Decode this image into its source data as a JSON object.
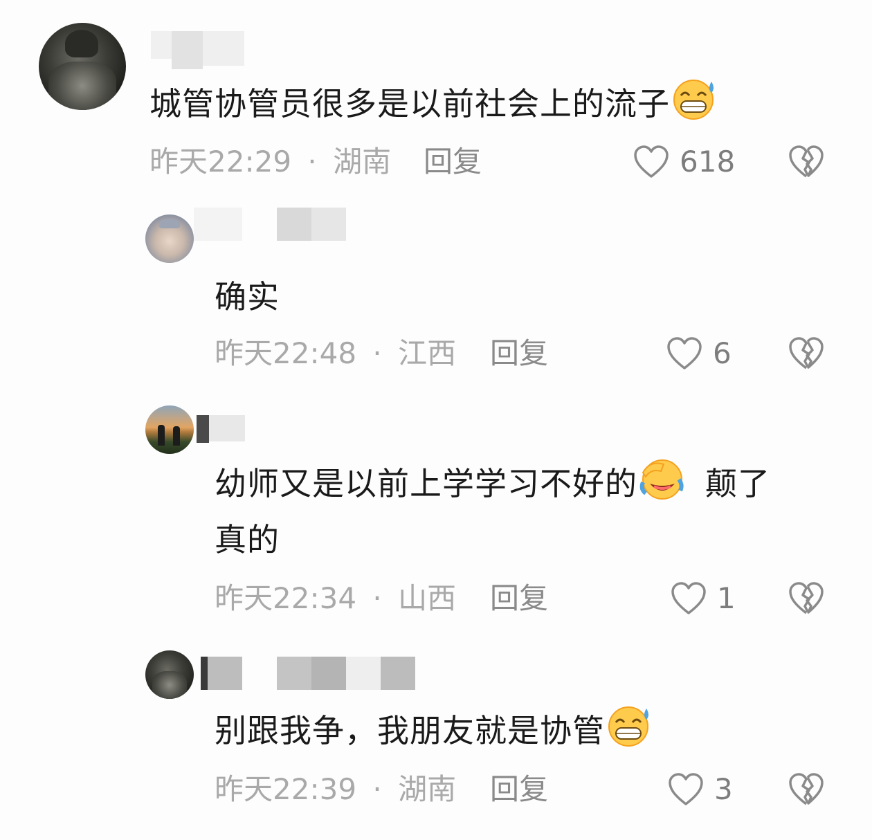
{
  "comments": [
    {
      "text": "城管协管员很多是以前社会上的流子",
      "emoji": "sweat-grin-emoji",
      "time": "昨天22:29",
      "location": "湖南",
      "reply": "回复",
      "likes": "618"
    },
    {
      "text": "确实",
      "time": "昨天22:48",
      "location": "江西",
      "reply": "回复",
      "likes": "6"
    },
    {
      "text_line1": "幼师又是以前上学学习不好的",
      "emoji": "laugh-cry-emoji",
      "text_line1_tail": "颠了",
      "text_line2": "真的",
      "time": "昨天22:34",
      "location": "山西",
      "reply": "回复",
      "likes": "1"
    },
    {
      "text": "别跟我争，我朋友就是协管",
      "emoji": "sweat-grin-emoji",
      "time": "昨天22:39",
      "location": "湖南",
      "reply": "回复",
      "likes": "3"
    }
  ],
  "separator": "·",
  "colors": {
    "text": "#1a1a1a",
    "meta": "#a9a9a9",
    "icon": "#8a8a8a",
    "background": "#fdfdfd"
  }
}
